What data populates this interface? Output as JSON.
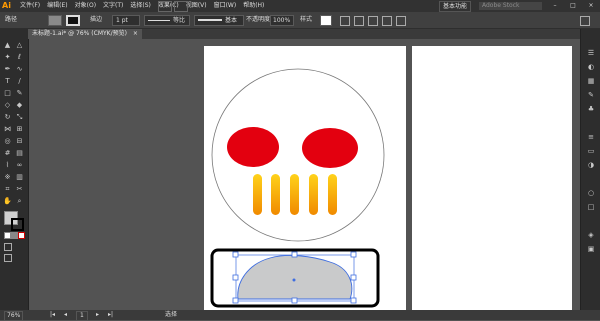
{
  "menubar": {
    "logo": "Ai",
    "items": [
      "文件(F)",
      "编辑(E)",
      "对象(O)",
      "文字(T)",
      "选择(S)",
      "效果(C)",
      "视图(V)",
      "窗口(W)",
      "帮助(H)"
    ],
    "workspace": "基本功能",
    "search_placeholder": "Adobe Stock",
    "window_controls": [
      "–",
      "□",
      "×"
    ]
  },
  "controlbar": {
    "selection_label": "路径",
    "stroke_label": "描边",
    "stroke_value": "1 pt",
    "profile_label": "等比",
    "brush_label": "基本",
    "opacity_label": "不透明度",
    "opacity_value": "100%",
    "style_label": "样式"
  },
  "document_tab": {
    "title": "未标题-1.ai* @ 76% (CMYK/预览)",
    "close": "×"
  },
  "statusbar": {
    "zoom": "76%",
    "page": "1",
    "tool": "选择"
  },
  "colors": {
    "eye": "#e3000f",
    "tooth_top": "#ffd21a",
    "tooth_bottom": "#f08a00",
    "jaw_fill": "#c9cacb",
    "selection": "#3f6ee0",
    "app_bg": "#535353"
  }
}
